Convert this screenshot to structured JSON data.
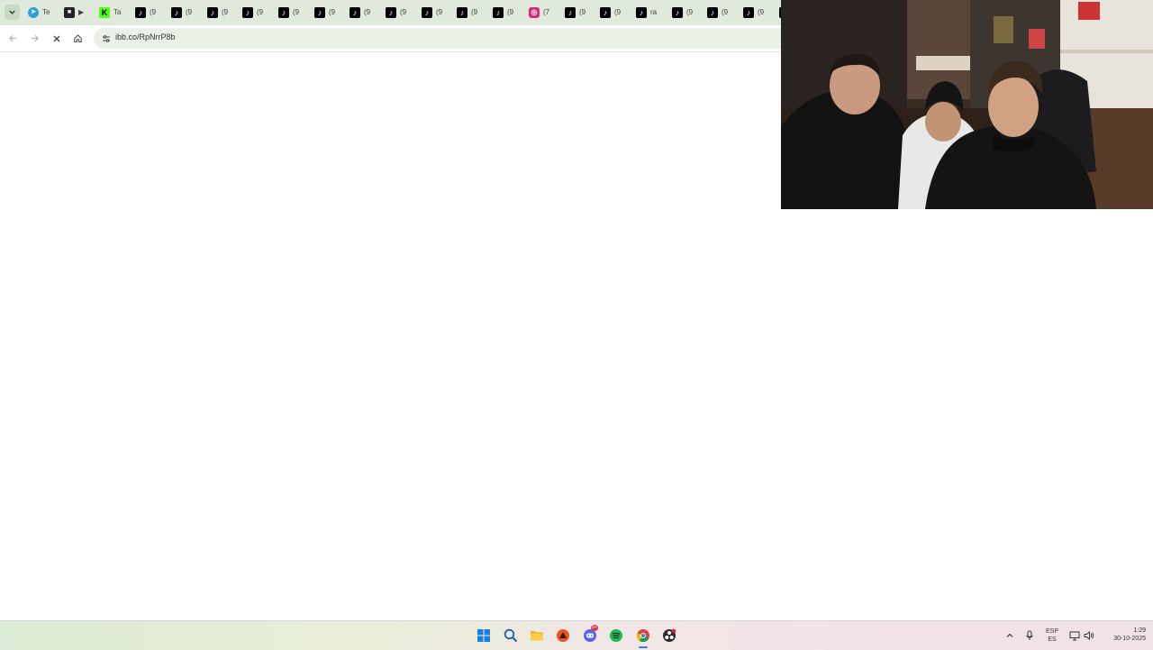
{
  "browser": {
    "tabs": [
      {
        "icon": "telegram-icon",
        "title": "Te",
        "color": "#2aa3e0"
      },
      {
        "icon": "video-app-icon",
        "title": "▶",
        "color": "#222222"
      },
      {
        "icon": "kick-icon",
        "title": "Ta",
        "color": "#53fc18"
      },
      {
        "icon": "tiktok-icon",
        "title": "(9",
        "color": "#000000"
      },
      {
        "icon": "tiktok-icon",
        "title": "(9",
        "color": "#000000"
      },
      {
        "icon": "tiktok-icon",
        "title": "(9",
        "color": "#000000"
      },
      {
        "icon": "tiktok-icon",
        "title": "(9",
        "color": "#000000"
      },
      {
        "icon": "tiktok-icon",
        "title": "(9",
        "color": "#000000"
      },
      {
        "icon": "tiktok-icon",
        "title": "(9",
        "color": "#000000"
      },
      {
        "icon": "tiktok-icon",
        "title": "(9",
        "color": "#000000"
      },
      {
        "icon": "tiktok-icon",
        "title": "(9",
        "color": "#000000"
      },
      {
        "icon": "tiktok-icon",
        "title": "(9",
        "color": "#000000"
      },
      {
        "icon": "tiktok-icon",
        "title": "(9",
        "color": "#000000"
      },
      {
        "icon": "tiktok-icon",
        "title": "(9",
        "color": "#000000"
      },
      {
        "icon": "instagram-icon",
        "title": "(7",
        "color": "#d62976"
      },
      {
        "icon": "tiktok-icon",
        "title": "(9",
        "color": "#000000"
      },
      {
        "icon": "tiktok-icon",
        "title": "(9",
        "color": "#000000"
      },
      {
        "icon": "tiktok-icon",
        "title": "ra",
        "color": "#000000"
      },
      {
        "icon": "tiktok-icon",
        "title": "(9",
        "color": "#000000"
      },
      {
        "icon": "tiktok-icon",
        "title": "(9",
        "color": "#000000"
      },
      {
        "icon": "tiktok-icon",
        "title": "(9",
        "color": "#000000"
      },
      {
        "icon": "tiktok-icon",
        "title": "(9",
        "color": "#000000"
      }
    ],
    "url": "ibb.co/RpNrrP8b",
    "loading": true
  },
  "taskbar": {
    "apps": [
      {
        "name": "start-icon"
      },
      {
        "name": "search-icon"
      },
      {
        "name": "file-explorer-icon"
      },
      {
        "name": "orange-app-icon"
      },
      {
        "name": "discord-icon",
        "badge": "9+"
      },
      {
        "name": "spotify-icon"
      },
      {
        "name": "chrome-icon"
      },
      {
        "name": "obs-icon"
      }
    ],
    "tray": {
      "language_top": "ESP",
      "language_bottom": "ES",
      "time": "1:29",
      "date": "30-10-2025"
    }
  }
}
